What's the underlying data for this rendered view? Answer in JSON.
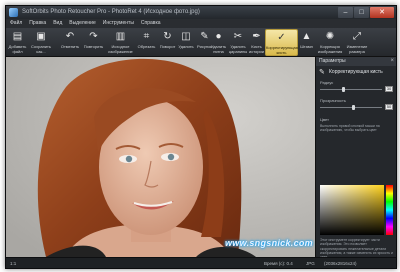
{
  "window": {
    "title": "SoftOrbits Photo Retoucher Pro - PhotoRet 4 (Исходное фото.jpg)",
    "controls": [
      "–",
      "□",
      "✕"
    ]
  },
  "menu": [
    "Файл",
    "Правка",
    "Вид",
    "Выделение",
    "Инструменты",
    "Справка"
  ],
  "toolbar": [
    {
      "label": "Добавить файл",
      "icon": "add-file-icon"
    },
    {
      "label": "Сохранить как...",
      "icon": "save-icon"
    },
    {
      "label": "Отменить",
      "icon": "undo-icon"
    },
    {
      "label": "Повторить",
      "icon": "redo-icon"
    },
    {
      "label": "Исходное изображение",
      "icon": "original-image-icon"
    },
    {
      "label": "Обрезать",
      "icon": "crop-icon"
    },
    {
      "label": "Поворот",
      "icon": "rotate-icon"
    },
    {
      "label": "Удалить",
      "icon": "eraser-icon"
    },
    {
      "label": "Рисунок",
      "icon": "pencil-icon"
    },
    {
      "label": "Удалить пятна",
      "icon": "spot-icon"
    },
    {
      "label": "Удалить царапины",
      "icon": "scratch-icon"
    },
    {
      "label": "Кисть истории",
      "icon": "history-brush-icon"
    },
    {
      "label": "Корректирующая кисть",
      "icon": "correction-brush-icon"
    },
    {
      "label": "Штамп",
      "icon": "stamp-icon"
    },
    {
      "label": "Коррекция изображения",
      "icon": "adjust-icon"
    },
    {
      "label": "Изменение размера",
      "icon": "resize-icon"
    }
  ],
  "panel": {
    "header": "Параметры",
    "tool_title": "Корректирующая кисть",
    "radius_label": "Радиус",
    "radius_value": "30",
    "radius_level": 0.38,
    "transparency_label": "Прозрачность",
    "transparency_value": "50",
    "transparency_level": 0.55,
    "color_label": "Цвет",
    "color_desc": "Выполнить правой кнопкой мыши на изображению, чтобы выбрать цвет",
    "footer_desc": "Этот инструмент корректирует части изображения. Это позволяет скорректировать нежелательные детали изображения, а также изменить их яркость и цвет"
  },
  "status": {
    "zoom": "1:1",
    "time": "Время (с): 0.4",
    "format": "JPG",
    "size": "(2036x2816x24)"
  },
  "watermark": "www.sngsnick.com",
  "colors": {
    "active": "#e8d27a",
    "panel": "#25282c"
  }
}
